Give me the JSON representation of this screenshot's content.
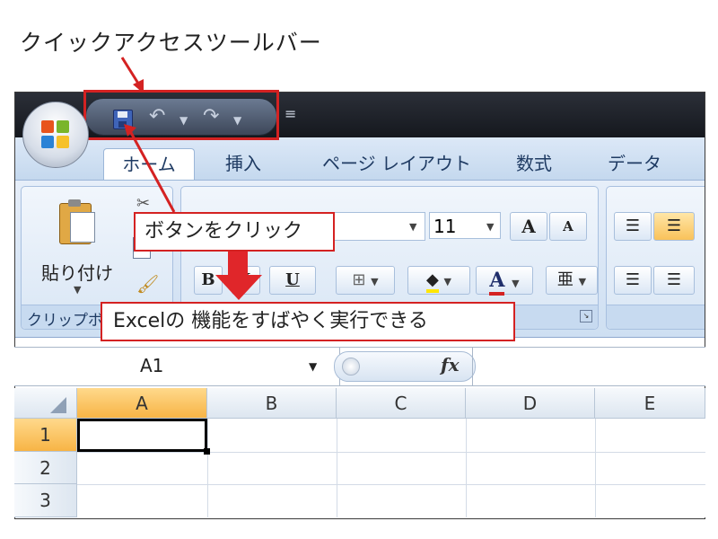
{
  "annotations": {
    "qat_label": "クイックアクセスツールバー",
    "callout_click": "ボタンをクリック",
    "callout_desc": "Excelの 機能をすばやく実行できる"
  },
  "ribbon": {
    "tabs": [
      {
        "label": "ホーム",
        "active": true
      },
      {
        "label": "挿入"
      },
      {
        "label": "ページ レイアウト"
      },
      {
        "label": "数式"
      },
      {
        "label": "データ"
      }
    ],
    "font_size": "11",
    "grow_font": "A",
    "shrink_font": "A",
    "bold": "B",
    "italic": "I",
    "underline": "U",
    "font_color_glyph": "A",
    "phonetic_glyph": "亜",
    "paste_label": "貼り付け",
    "clipboard_group": "クリップボ"
  },
  "formula_bar": {
    "name_box": "A1",
    "fx": "fx"
  },
  "sheet": {
    "columns": [
      "A",
      "B",
      "C",
      "D",
      "E"
    ],
    "rows": [
      "1",
      "2",
      "3"
    ],
    "active_cell": "A1"
  },
  "icons": {
    "save": "save-icon",
    "undo": "undo-icon",
    "redo": "redo-icon",
    "customize_qat": "customize-qat-icon",
    "office_button": "office-logo-icon",
    "paste": "paste-icon",
    "borders": "borders-icon",
    "fill_color": "fill-color-icon",
    "dialog_launcher": "dialog-launcher-icon"
  },
  "colors": {
    "highlight": "#d42222",
    "tab_text": "#1f3b63",
    "selected_header": "#f7b445"
  }
}
